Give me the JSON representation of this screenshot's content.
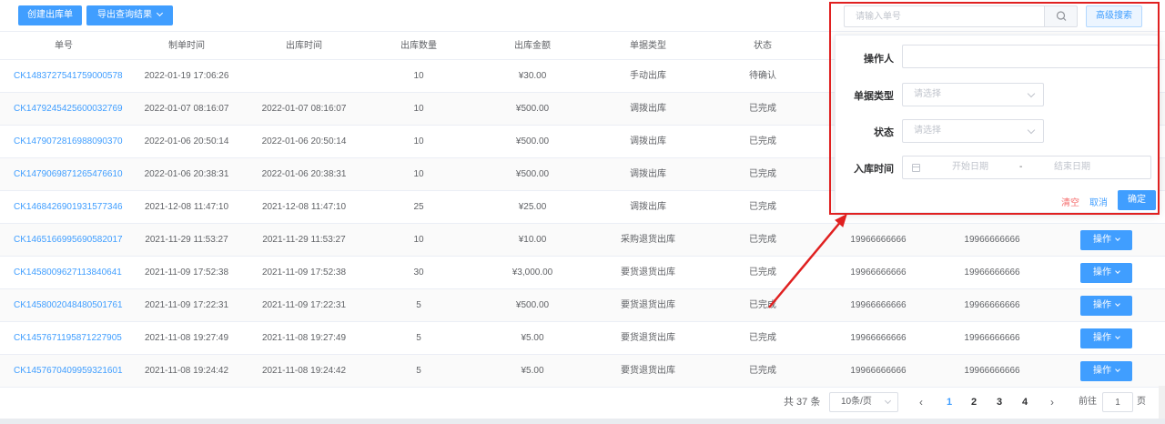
{
  "toolbar": {
    "create_label": "创建出库单",
    "export_label": "导出查询结果"
  },
  "search": {
    "placeholder": "请输入单号",
    "advanced_label": "高级搜索"
  },
  "columns": [
    "单号",
    "制单时间",
    "出库时间",
    "出库数量",
    "出库金额",
    "单据类型",
    "状态"
  ],
  "rows": [
    {
      "id": "CK1483727541759000578",
      "created": "2022-01-19 17:06:26",
      "out_time": "",
      "qty": "10",
      "amount": "¥30.00",
      "type": "手动出库",
      "status": "待确认",
      "c1": "",
      "c2": "",
      "op": ""
    },
    {
      "id": "CK1479245425600032769",
      "created": "2022-01-07 08:16:07",
      "out_time": "2022-01-07 08:16:07",
      "qty": "10",
      "amount": "¥500.00",
      "type": "调拨出库",
      "status": "已完成",
      "c1": "",
      "c2": "",
      "op": ""
    },
    {
      "id": "CK1479072816988090370",
      "created": "2022-01-06 20:50:14",
      "out_time": "2022-01-06 20:50:14",
      "qty": "10",
      "amount": "¥500.00",
      "type": "调拨出库",
      "status": "已完成",
      "c1": "",
      "c2": "",
      "op": ""
    },
    {
      "id": "CK1479069871265476610",
      "created": "2022-01-06 20:38:31",
      "out_time": "2022-01-06 20:38:31",
      "qty": "10",
      "amount": "¥500.00",
      "type": "调拨出库",
      "status": "已完成",
      "c1": "",
      "c2": "",
      "op": ""
    },
    {
      "id": "CK1468426901931577346",
      "created": "2021-12-08 11:47:10",
      "out_time": "2021-12-08 11:47:10",
      "qty": "25",
      "amount": "¥25.00",
      "type": "调拨出库",
      "status": "已完成",
      "c1": "",
      "c2": "",
      "op": ""
    },
    {
      "id": "CK1465166995690582017",
      "created": "2021-11-29 11:53:27",
      "out_time": "2021-11-29 11:53:27",
      "qty": "10",
      "amount": "¥10.00",
      "type": "采购退货出库",
      "status": "已完成",
      "c1": "19966666666",
      "c2": "19966666666",
      "op": "操作"
    },
    {
      "id": "CK1458009627113840641",
      "created": "2021-11-09 17:52:38",
      "out_time": "2021-11-09 17:52:38",
      "qty": "30",
      "amount": "¥3,000.00",
      "type": "要货退货出库",
      "status": "已完成",
      "c1": "19966666666",
      "c2": "19966666666",
      "op": "操作"
    },
    {
      "id": "CK1458002048480501761",
      "created": "2021-11-09 17:22:31",
      "out_time": "2021-11-09 17:22:31",
      "qty": "5",
      "amount": "¥500.00",
      "type": "要货退货出库",
      "status": "已完成",
      "c1": "19966666666",
      "c2": "19966666666",
      "op": "操作"
    },
    {
      "id": "CK1457671195871227905",
      "created": "2021-11-08 19:27:49",
      "out_time": "2021-11-08 19:27:49",
      "qty": "5",
      "amount": "¥5.00",
      "type": "要货退货出库",
      "status": "已完成",
      "c1": "19966666666",
      "c2": "19966666666",
      "op": "操作"
    },
    {
      "id": "CK1457670409959321601",
      "created": "2021-11-08 19:24:42",
      "out_time": "2021-11-08 19:24:42",
      "qty": "5",
      "amount": "¥5.00",
      "type": "要货退货出库",
      "status": "已完成",
      "c1": "19966666666",
      "c2": "19966666666",
      "op": "操作"
    }
  ],
  "panel": {
    "operator_label": "操作人",
    "operator_value": "",
    "doc_type_label": "单据类型",
    "doc_type_placeholder": "请选择",
    "status_label": "状态",
    "status_placeholder": "请选择",
    "in_time_label": "入库时间",
    "start_placeholder": "开始日期",
    "range_sep": "-",
    "end_placeholder": "结束日期",
    "clear_label": "清空",
    "cancel_label": "取消",
    "confirm_label": "确定"
  },
  "pagination": {
    "total": "共 37 条",
    "page_size": "10条/页",
    "prev": "‹",
    "next": "›",
    "pages": [
      "1",
      "2",
      "3",
      "4"
    ],
    "current": "1",
    "goto_label": "前往",
    "goto_value": "1",
    "goto_suffix": "页"
  },
  "colors": {
    "primary": "#409eff",
    "annotation": "#e02020",
    "danger": "#f56c6c"
  }
}
